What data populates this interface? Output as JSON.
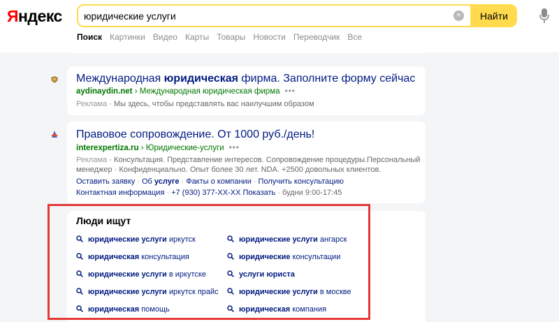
{
  "header": {
    "logo_first": "Я",
    "logo_rest": "ндекс",
    "search_value": "юридические услуги",
    "clear_label": "×",
    "find_label": "Найти",
    "tabs": [
      "Поиск",
      "Картинки",
      "Видео",
      "Карты",
      "Товары",
      "Новости",
      "Переводчик",
      "Все"
    ]
  },
  "results": [
    {
      "title_pre": "Международная ",
      "title_bold": "юридическая",
      "title_post": " фирма. Заполните форму сейчас",
      "domain": "aydinaydin.net",
      "breadcrumb": "Международная юридическая фирма",
      "dots": "•••",
      "ad_label": "Реклама",
      "description": "Мы здесь, чтобы представлять вас наилучшим образом"
    },
    {
      "title": "Правовое сопровождение. От 1000 руб./день!",
      "domain": "interexpertiza.ru",
      "breadcrumb": "Юридические-услуги",
      "dots": "•••",
      "ad_label": "Реклама",
      "description_1": "Консультация. Представление интересов. Сопровождение процедуры.Персональный",
      "description_2": "менеджер · Конфиденциально. Опыт более 30 лет. NDA. +2500 довольных клиентов.",
      "sitelinks": {
        "order": "Оставить заявку",
        "about_pre": "Об ",
        "about_bold": "услуге",
        "facts": "Факты о компании",
        "consult": "Получить консультацию"
      },
      "contacts": {
        "label": "Контактная информация",
        "phone": "+7 (930) 377-ХХ-ХХ Показать",
        "hours": "будни 9:00-17:45"
      }
    }
  ],
  "people_search": {
    "title": "Люди ищут",
    "items": [
      {
        "bold": "юридические услуги",
        "rest": " иркутск"
      },
      {
        "bold": "юридические услуги",
        "rest": " ангарск"
      },
      {
        "bold": "юридическая",
        "rest": " консультация"
      },
      {
        "bold": "юридические",
        "rest": " консультации"
      },
      {
        "bold": "юридические услуги",
        "rest": " в иркутске"
      },
      {
        "bold": "услуги юриста",
        "rest": ""
      },
      {
        "bold": "юридические услуги",
        "rest": " иркутск прайс"
      },
      {
        "bold": "юридические услуги",
        "rest": " в москве"
      },
      {
        "bold": "юридическая",
        "rest": " помощь"
      },
      {
        "bold": "юридическая",
        "rest": " компания"
      }
    ]
  },
  "colors": {
    "accent_yellow": "#ffdb4d",
    "link_blue": "#001a80",
    "url_green": "#007700",
    "highlight_red": "#e53935"
  }
}
